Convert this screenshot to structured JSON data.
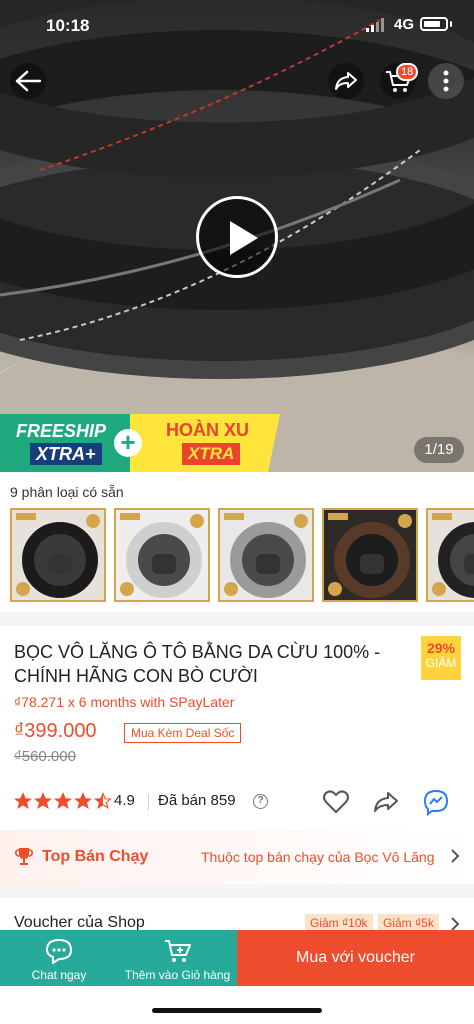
{
  "status_bar": {
    "time": "10:18",
    "network": "4G"
  },
  "header": {
    "cart_count": "18"
  },
  "gallery": {
    "counter": "1/19",
    "promo_freeship": "FREESHIP",
    "promo_freeship_xtra": "XTRA+",
    "promo_plus": "+",
    "promo_hoanxu": "HOÀN XU",
    "promo_hoanxu_xtra": "XTRA"
  },
  "variants": {
    "label": "9 phân loại có sẵn"
  },
  "product": {
    "title": "BỌC VÔ LĂNG Ô TÔ BẰNG DA CỪU 100% - CHÍNH HÃNG CON BÒ CƯỜI",
    "discount_percent": "29%",
    "discount_word": "GIẢM",
    "spaylater": "₫78.271 x 6 months with SPayLater",
    "price": "₫399.000",
    "deal_label": "Mua Kèm Deal Sốc",
    "old_price": "₫560.000",
    "rating": "4.9",
    "stars": 4.5,
    "sold": "Đã bán 859"
  },
  "top_seller": {
    "label": "Top Bán Chạy",
    "description": "Thuộc top bán chạy của Bọc Vô Lăng"
  },
  "voucher": {
    "label": "Voucher của Shop",
    "tags": [
      "Giảm ₫10k",
      "Giảm ₫5k"
    ]
  },
  "bottom_bar": {
    "chat_label": "Chat ngay",
    "cart_label": "Thêm vào Giỏ hàng",
    "buy_label": "Mua với voucher"
  },
  "colors": {
    "accent": "#ee4d2d",
    "teal": "#26aa99"
  }
}
